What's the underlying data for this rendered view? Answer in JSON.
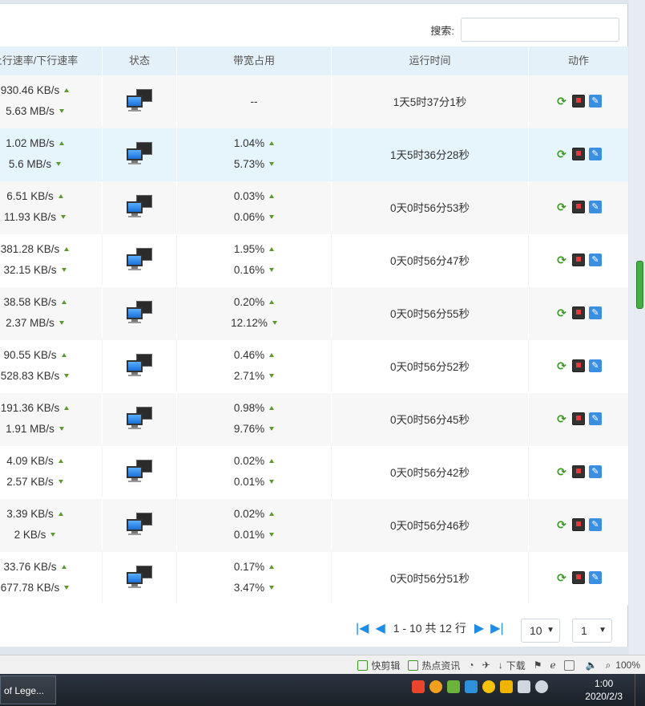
{
  "search": {
    "label": "搜索:",
    "value": "",
    "placeholder": ""
  },
  "columns": {
    "speed": "上行速率/下行速率",
    "status": "状态",
    "bandwidth": "带宽占用",
    "runtime": "运行时间",
    "actions": "动作"
  },
  "rows": [
    {
      "up": "930.46 KB/s",
      "down": "5.63 MB/s",
      "bw_up": "--",
      "bw_down": "",
      "runtime": "1天5时37分1秒"
    },
    {
      "up": "1.02 MB/s",
      "down": "5.6 MB/s",
      "bw_up": "1.04%",
      "bw_down": "5.73%",
      "runtime": "1天5时36分28秒"
    },
    {
      "up": "6.51 KB/s",
      "down": "11.93 KB/s",
      "bw_up": "0.03%",
      "bw_down": "0.06%",
      "runtime": "0天0时56分53秒"
    },
    {
      "up": "381.28 KB/s",
      "down": "32.15 KB/s",
      "bw_up": "1.95%",
      "bw_down": "0.16%",
      "runtime": "0天0时56分47秒"
    },
    {
      "up": "38.58 KB/s",
      "down": "2.37 MB/s",
      "bw_up": "0.20%",
      "bw_down": "12.12%",
      "runtime": "0天0时56分55秒"
    },
    {
      "up": "90.55 KB/s",
      "down": "528.83 KB/s",
      "bw_up": "0.46%",
      "bw_down": "2.71%",
      "runtime": "0天0时56分52秒"
    },
    {
      "up": "191.36 KB/s",
      "down": "1.91 MB/s",
      "bw_up": "0.98%",
      "bw_down": "9.76%",
      "runtime": "0天0时56分45秒"
    },
    {
      "up": "4.09 KB/s",
      "down": "2.57 KB/s",
      "bw_up": "0.02%",
      "bw_down": "0.01%",
      "runtime": "0天0时56分42秒"
    },
    {
      "up": "3.39 KB/s",
      "down": "2 KB/s",
      "bw_up": "0.02%",
      "bw_down": "0.01%",
      "runtime": "0天0时56分46秒"
    },
    {
      "up": "33.76 KB/s",
      "down": "677.78 KB/s",
      "bw_up": "0.17%",
      "bw_down": "3.47%",
      "runtime": "0天0时56分51秒"
    }
  ],
  "pager": {
    "info": "1 - 10 共 12 行",
    "page_size": "10",
    "page": "1"
  },
  "statusbar": {
    "quick_edit": "快剪辑",
    "hot_news": "热点资讯",
    "download": "下载",
    "zoom": "100%"
  },
  "taskbar": {
    "task_label": "of Lege...",
    "time": "1:00",
    "date": "2020/2/3"
  },
  "colors": {
    "header_bg": "#e5f1f9",
    "row_highlight": "#e6f5fc",
    "arrow_green": "#5c9a2f",
    "link_blue": "#1f8ce6"
  }
}
